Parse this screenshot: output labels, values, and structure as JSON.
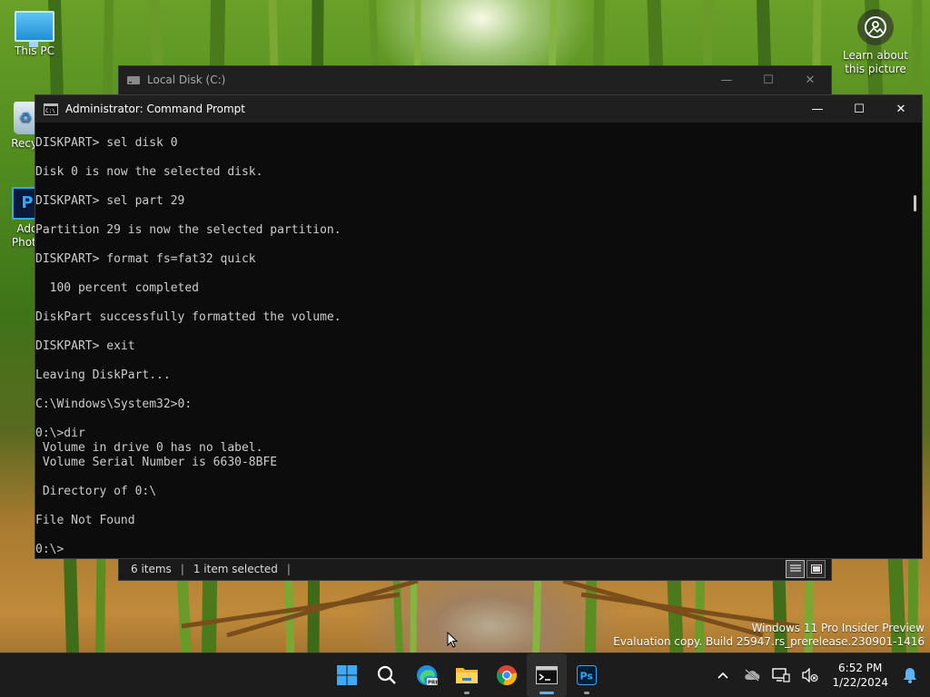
{
  "desktop": {
    "icons": [
      {
        "label": "This PC"
      },
      {
        "label": "Recyc"
      },
      {
        "label": "Add Photo"
      }
    ],
    "learn_about_picture": "Learn about this picture"
  },
  "explorer": {
    "title": "Local Disk (C:)",
    "status_items": "6 items",
    "status_selected": "1 item selected"
  },
  "cmd": {
    "title": "Administrator: Command Prompt",
    "lines": [
      "DISKPART> sel disk 0",
      "",
      "Disk 0 is now the selected disk.",
      "",
      "DISKPART> sel part 29",
      "",
      "Partition 29 is now the selected partition.",
      "",
      "DISKPART> format fs=fat32 quick",
      "",
      "  100 percent completed",
      "",
      "DiskPart successfully formatted the volume.",
      "",
      "DISKPART> exit",
      "",
      "Leaving DiskPart...",
      "",
      "C:\\Windows\\System32>0:",
      "",
      "0:\\>dir",
      " Volume in drive 0 has no label.",
      " Volume Serial Number is 6630-8BFE",
      "",
      " Directory of 0:\\",
      "",
      "File Not Found",
      "",
      "0:\\>"
    ]
  },
  "watermark": {
    "line1": "Windows 11 Pro Insider Preview",
    "line2": "Evaluation copy. Build 25947.rs_prerelease.230901-1416"
  },
  "taskbar": {
    "time": "6:52 PM",
    "date": "1/22/2024"
  },
  "colors": {
    "accent": "#5fb2f2",
    "console_bg": "#0c0c0c",
    "console_fg": "#cccccc",
    "taskbar_bg": "#1c1c1c"
  }
}
